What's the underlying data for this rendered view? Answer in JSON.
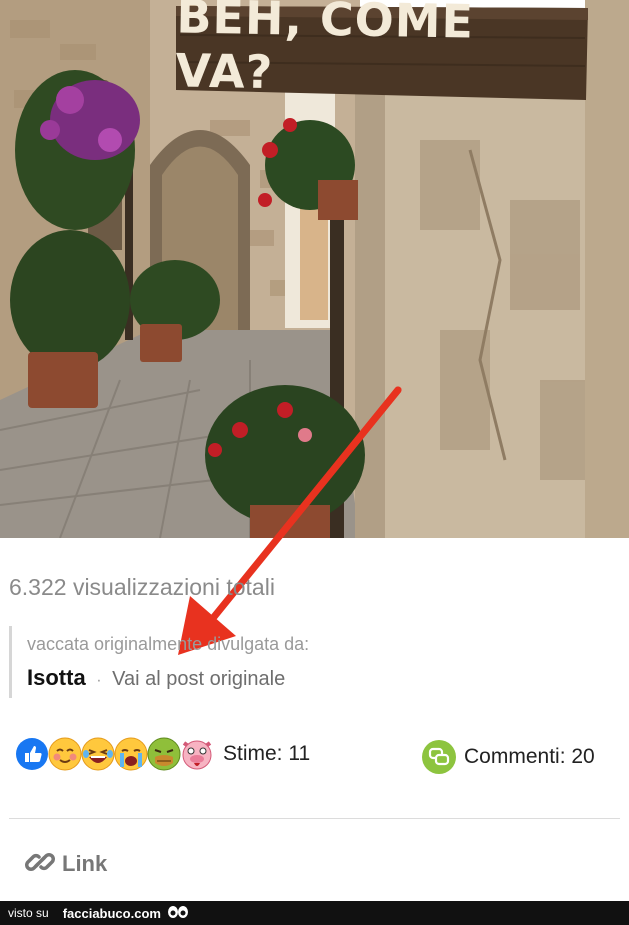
{
  "post": {
    "image": {
      "sign_text": "BEH, COME VA?"
    },
    "views_text": "6.322 visualizzazioni totali",
    "attribution": {
      "prefix": "vaccata originalmente divulgata da:",
      "author": "Isotta",
      "separator": "·",
      "original_post_link": "Vai al post originale"
    },
    "reactions": {
      "emojis": [
        "thumbs-up-icon",
        "blushing-face-icon",
        "laughing-face-icon",
        "crying-face-icon",
        "sick-face-icon",
        "pig-face-icon"
      ],
      "likes_label": "Stime: 11"
    },
    "comments_label": "Commenti: 20",
    "link_label": "Link"
  },
  "footer": {
    "visto_su": "visto su",
    "site": "facciabuco.com"
  },
  "colors": {
    "accent_green": "#8dc43f",
    "like_blue": "#1877f2",
    "arrow_red": "#e8321f",
    "footer_bg": "#111111"
  }
}
